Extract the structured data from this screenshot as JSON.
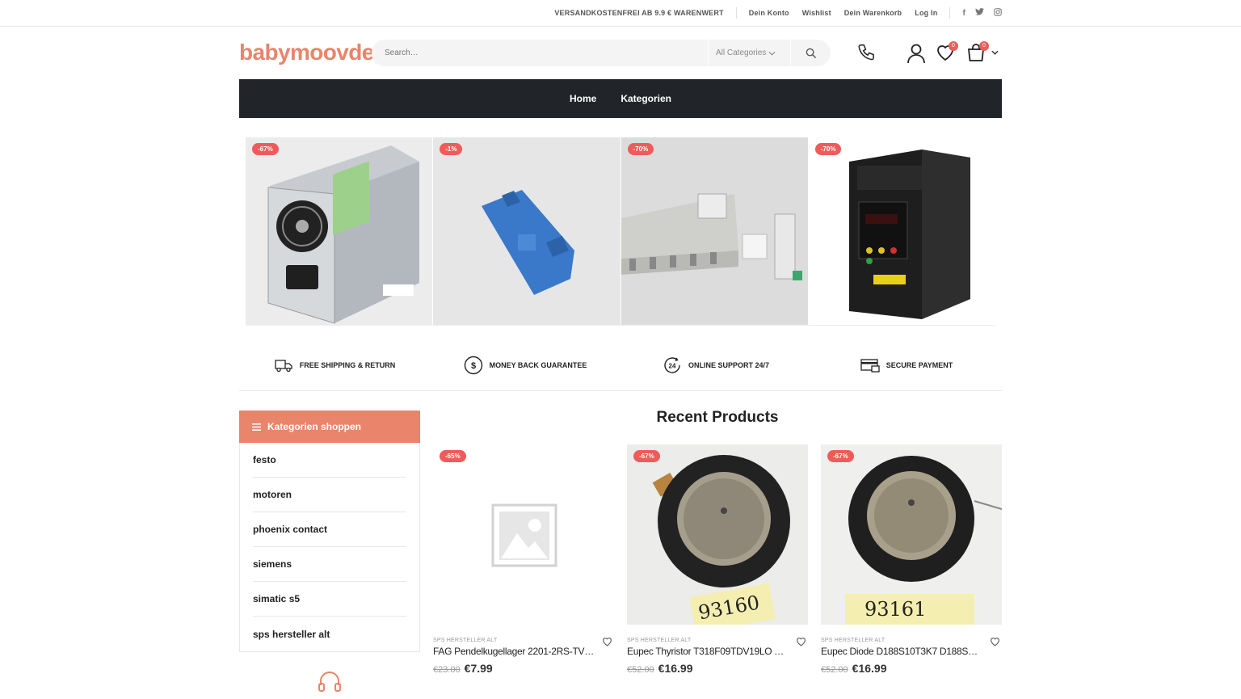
{
  "topbar": {
    "promo": "VERSANDKOSTENFREI AB 9.9 € WARENWERT",
    "links": [
      "Dein Konto",
      "Wishlist",
      "Dein Warenkorb",
      "Log In"
    ],
    "social_icons": [
      "facebook-icon",
      "twitter-icon",
      "instagram-icon"
    ]
  },
  "header": {
    "logo": "babymoovde",
    "search": {
      "placeholder": "Search…",
      "category": "All Categories"
    },
    "wishlist_count": "0",
    "cart_count": "0"
  },
  "nav": {
    "items": [
      "Home",
      "Kategorien"
    ]
  },
  "banners": [
    {
      "badge": "-67%"
    },
    {
      "badge": "-1%"
    },
    {
      "badge": "-70%"
    },
    {
      "badge": "-70%"
    }
  ],
  "features": [
    "FREE SHIPPING & RETURN",
    "MONEY BACK GUARANTEE",
    "ONLINE SUPPORT 24/7",
    "SECURE PAYMENT"
  ],
  "sidebar": {
    "title": "Kategorien shoppen",
    "items": [
      "festo",
      "motoren",
      "phoenix contact",
      "siemens",
      "simatic s5",
      "sps hersteller alt"
    ]
  },
  "section": {
    "title": "Recent Products"
  },
  "products": [
    {
      "badge": "-65%",
      "category": "SPS HERSTELLER ALT",
      "name": "FAG Pendelkugellager 2201-2RS-TVH /…",
      "old_price": "€23.00",
      "price": "€7.99"
    },
    {
      "badge": "-67%",
      "category": "SPS HERSTELLER ALT",
      "name": "Eupec Thyristor T318F09TDV19LO T31…",
      "old_price": "€52.00",
      "price": "€16.99",
      "label": "93160"
    },
    {
      "badge": "-67%",
      "category": "SPS HERSTELLER ALT",
      "name": "Eupec Diode D188S10T3K7 D188S10 …",
      "old_price": "€52.00",
      "price": "€16.99",
      "label": "93161"
    }
  ],
  "colors": {
    "accent": "#e8856a",
    "sale": "#ef5b5b",
    "nav_bg": "#212529"
  }
}
